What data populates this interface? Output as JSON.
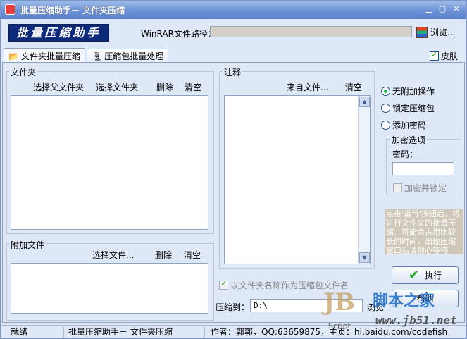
{
  "window": {
    "title": "批量压缩助手－ 文件夹压缩"
  },
  "logo": {
    "text": "批量压缩助手"
  },
  "top": {
    "winrar_path_label": "WinRAR文件路径：",
    "winrar_path_value": "",
    "browse_label": "浏览..."
  },
  "tabs": [
    {
      "label": "文件夹批量压缩",
      "icon": "folder-open-icon",
      "active": true
    },
    {
      "label": "压缩包批量处理",
      "icon": "archive-icon",
      "active": false
    }
  ],
  "skin": {
    "label": "皮肤",
    "checked": true
  },
  "folders": {
    "title": "文件夹",
    "select_parent": "选择父文件夹",
    "select_folder": "选择文件夹",
    "delete": "删除",
    "clear": "清空",
    "items": []
  },
  "extra_files": {
    "title": "附加文件",
    "select_files": "选择文件...",
    "delete": "删除",
    "clear": "清空",
    "items": []
  },
  "comment": {
    "title": "注释",
    "from_file": "来自文件...",
    "clear": "清空",
    "text": ""
  },
  "options": {
    "radios": [
      {
        "label": "无附加操作",
        "checked": true
      },
      {
        "label": "锁定压缩包",
        "checked": false
      },
      {
        "label": "添加密码",
        "checked": false
      }
    ],
    "encrypt_group_title": "加密选项",
    "password_label": "密码：",
    "password_value": "",
    "encrypt_lock_label": "加密并锁定"
  },
  "hint_text": "点击'运行'按钮后，将进行文件夹的批量压缩。可能会占用比较长的时间，出现压缩窗口后请耐心等待",
  "use_folder_name": {
    "label": "以文件夹名称作为压缩包文件名",
    "checked": true
  },
  "output": {
    "label": "压缩到：",
    "value": "D:\\",
    "browse_label": "浏览"
  },
  "buttons": {
    "run": "执行",
    "help": "帮助"
  },
  "status": {
    "ready": "就绪",
    "app": "批量压缩助手－ 文件夹压缩",
    "author": "作者：郭郭，QQ:63659875，主页：hi.baidu.com/codefish"
  },
  "watermark": {
    "jb": "JB",
    "script": "Script",
    "site_cn": "脚本之家",
    "site_url": "www.jb51.net"
  },
  "colors": {
    "title_bar": "#6c92d6",
    "panel": "#dfe8f6",
    "border": "#8ea2c6",
    "hint_bg": "#cfc8b8",
    "run_check": "#19a119"
  }
}
